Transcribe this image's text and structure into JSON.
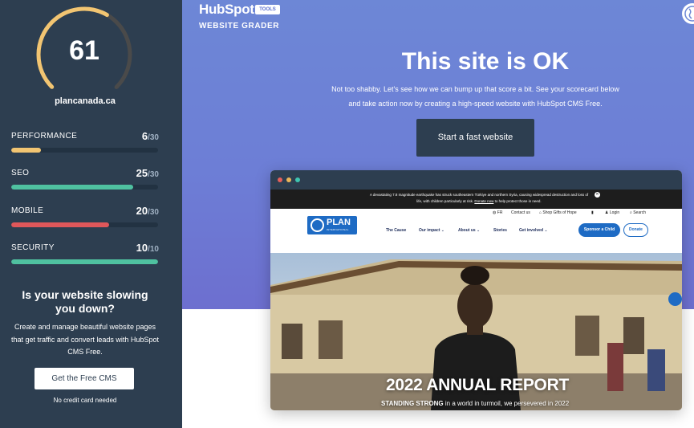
{
  "sidebar": {
    "score": "61",
    "score_fraction": 0.61,
    "domain": "plancanada.ca",
    "metrics": [
      {
        "label": "PERFORMANCE",
        "score": "6",
        "max": "/30",
        "fraction": 0.2,
        "color": "#f2c572"
      },
      {
        "label": "SEO",
        "score": "25",
        "max": "/30",
        "fraction": 0.833,
        "color": "#4fc1a0"
      },
      {
        "label": "MOBILE",
        "score": "20",
        "max": "/30",
        "fraction": 0.667,
        "color": "#e0575a"
      },
      {
        "label": "SECURITY",
        "score": "10",
        "max": "/10",
        "fraction": 1.0,
        "color": "#4fc1a0"
      }
    ],
    "cta": {
      "title_line1": "Is your website slowing",
      "title_line2": "you down?",
      "text_line1": "Create and manage beautiful website pages",
      "text_line2": "that get traffic and convert leads with HubSpot",
      "text_line3": "CMS Free.",
      "button": "Get the Free CMS",
      "note": "No credit card needed"
    }
  },
  "header": {
    "logo": "HubSpot",
    "badge": "TOOLS",
    "product": "WEBSITE GRADER",
    "globe_icon": "globe-icon"
  },
  "hero": {
    "headline": "This site is OK",
    "sub_line1": "Not too shabby. Let's see how we can bump up that score a bit. See your scorecard below",
    "sub_line2": "and take action now by creating a high-speed website with HubSpot CMS Free.",
    "button": "Start a fast website"
  },
  "preview": {
    "alert_line1": "A devastating 7.8 magnitude earthquake has struck southeastern Türkiye and northern Syria, causing widespread destruction and loss of",
    "alert_line2_a": "life, with children particularly at risk.",
    "alert_line2_link": "Donate now",
    "alert_line2_b": "to help protect those in need.",
    "topnav": [
      "FR",
      "Contact us",
      "Shop Gifts of Hope",
      "Login",
      "Search"
    ],
    "logo_text": "PLAN",
    "logo_sub": "INTERNATIONAL",
    "mainnav": [
      "The Cause",
      "Our impact",
      "About us",
      "Stories",
      "Get involved"
    ],
    "sponsor": "Sponsor a Child",
    "donate": "Donate",
    "report_title": "2022 ANNUAL REPORT",
    "report_sub_bold": "STANDING STRONG",
    "report_sub_rest": "in a world in turmoil, we persevered in 2022"
  },
  "colors": {
    "sidebar_bg": "#2d3e50",
    "hero_bg": "#6d7ed6",
    "gauge_yellow": "#f2c572",
    "brand_blue": "#1e6bc4"
  }
}
